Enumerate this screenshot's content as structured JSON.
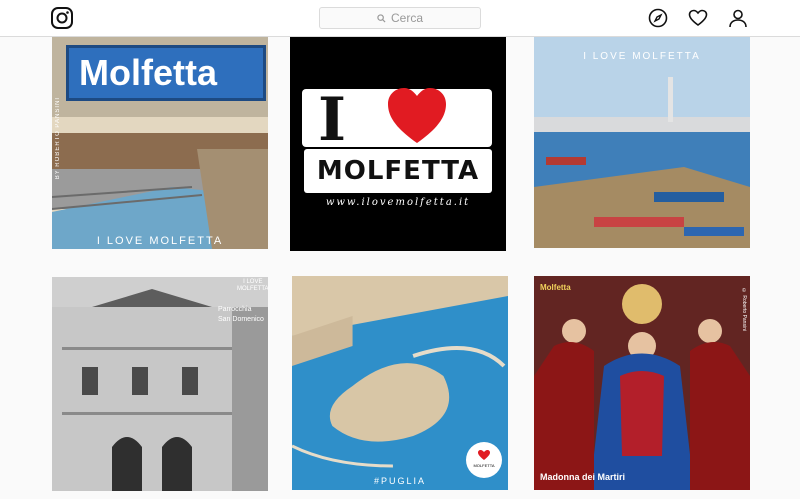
{
  "header": {
    "logo_icon": "instagram-logo-icon",
    "search_placeholder": "Cerca",
    "nav_icons": [
      "compass-icon",
      "heart-icon",
      "profile-icon"
    ]
  },
  "posts": [
    {
      "sign_text": "Molfetta",
      "vertical_credit": "BY ROBERTO PANSINI",
      "caption": "I LOVE MOLFETTA"
    },
    {
      "big_i": "I",
      "molfetta_word": "MOLFETTA",
      "site": "www.ilovemolfetta.it"
    },
    {
      "caption": "I LOVE MOLFETTA"
    },
    {
      "tag": "I LOVE MOLFETTA",
      "label_line1": "Parrocchia",
      "label_line2": "San Domenico"
    },
    {
      "caption": "#PUGLIA",
      "badge_text": "MOLFETTA"
    },
    {
      "top_label": "Molfetta",
      "bottom_label": "Madonna dei Martiri",
      "credit": "© Roberto Pansini"
    }
  ]
}
